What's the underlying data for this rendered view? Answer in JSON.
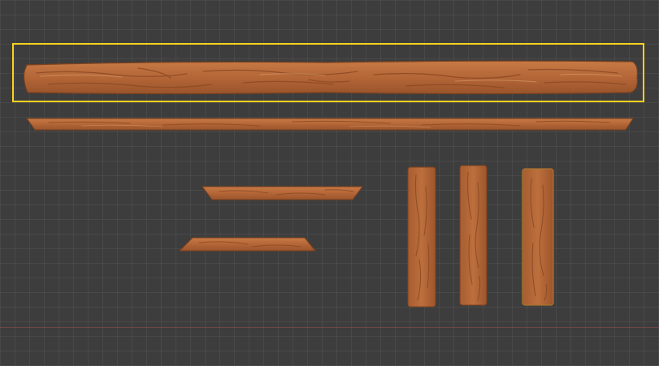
{
  "viewport": {
    "background_color": "#3d3d3d",
    "grid_color": "#4a4a4a",
    "axis_color": "#7a4b47"
  },
  "selection": {
    "color": "#ffd21e",
    "selected_object": "plank-long-thick"
  },
  "wood": {
    "base_color": "#b86a3a",
    "dark_color": "#8a4a24",
    "highlight_color": "#d9935c",
    "outline_color": "#6b3a1c"
  }
}
